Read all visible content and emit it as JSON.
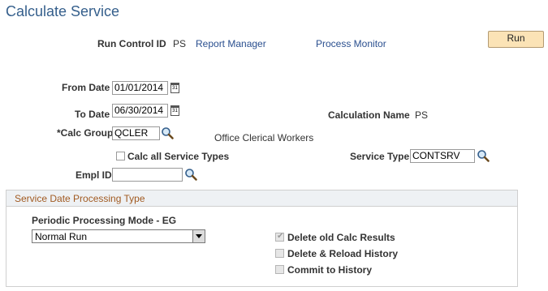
{
  "page": {
    "title": "Calculate Service"
  },
  "header": {
    "run_control_label": "Run Control ID",
    "run_control_value": "PS",
    "report_manager": "Report Manager",
    "process_monitor": "Process Monitor",
    "run_label": "Run"
  },
  "form": {
    "from_date_label": "From Date",
    "from_date_value": "01/01/2014",
    "to_date_label": "To Date",
    "to_date_value": "06/30/2014",
    "calc_name_label": "Calculation Name",
    "calc_name_value": "PS",
    "calc_group_label": "*Calc Group",
    "calc_group_value": "QCLER",
    "calc_group_desc": "Office Clerical Workers",
    "calc_all_label": "Calc all Service Types",
    "calc_all_checked": false,
    "service_type_label": "Service Type",
    "service_type_value": "CONTSRV",
    "empl_id_label": "Empl ID",
    "empl_id_value": "",
    "calendar_icon_text": "31"
  },
  "group": {
    "title": "Service Date Processing Type",
    "mode_label": "Periodic Processing Mode - EG",
    "mode_value": "Normal Run",
    "delete_old_label": "Delete old Calc Results",
    "delete_old_checked": true,
    "delete_reload_label": "Delete & Reload History",
    "delete_reload_checked": false,
    "commit_label": "Commit to History",
    "commit_checked": false
  },
  "icons": {
    "calendar": "calendar-icon",
    "lookup": "magnifier-lookup-icon",
    "dropdown": "chevron-down-icon",
    "checkmark": "checkmark-icon"
  },
  "colors": {
    "title": "#355f8c",
    "link": "#2a4f8f",
    "group_title": "#a15a21",
    "run_button": "#fbe3b6"
  }
}
